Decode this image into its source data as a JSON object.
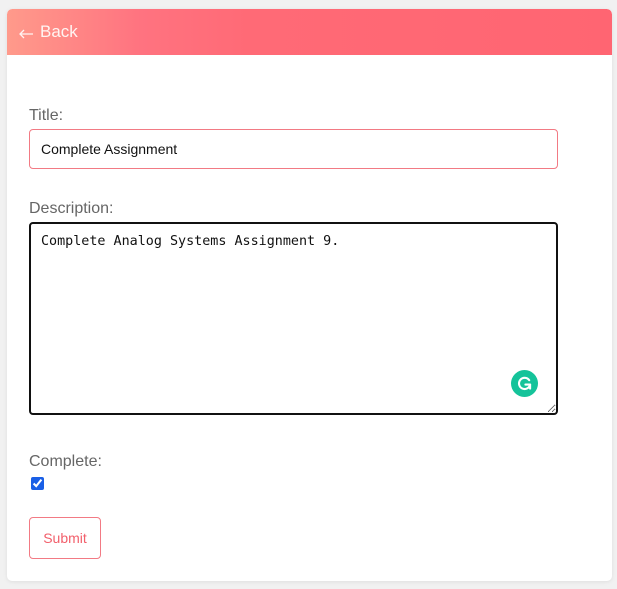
{
  "header": {
    "back_label": "Back",
    "back_icon": "left-arrow-icon",
    "gradient_start": "#ff9a8b",
    "gradient_end": "#ff6572"
  },
  "form": {
    "title_label": "Title:",
    "title_value": "Complete Assignment",
    "description_label": "Description:",
    "description_value": "Complete Analog Systems Assignment 9.",
    "complete_label": "Complete:",
    "complete_checked": true,
    "submit_label": "Submit"
  },
  "extensions": {
    "grammarly_icon": "grammarly-icon",
    "grammarly_color": "#15c39a"
  },
  "colors": {
    "accent": "#f25f6b",
    "border_accent": "#f27a84",
    "checkbox": "#1a5fe6"
  }
}
